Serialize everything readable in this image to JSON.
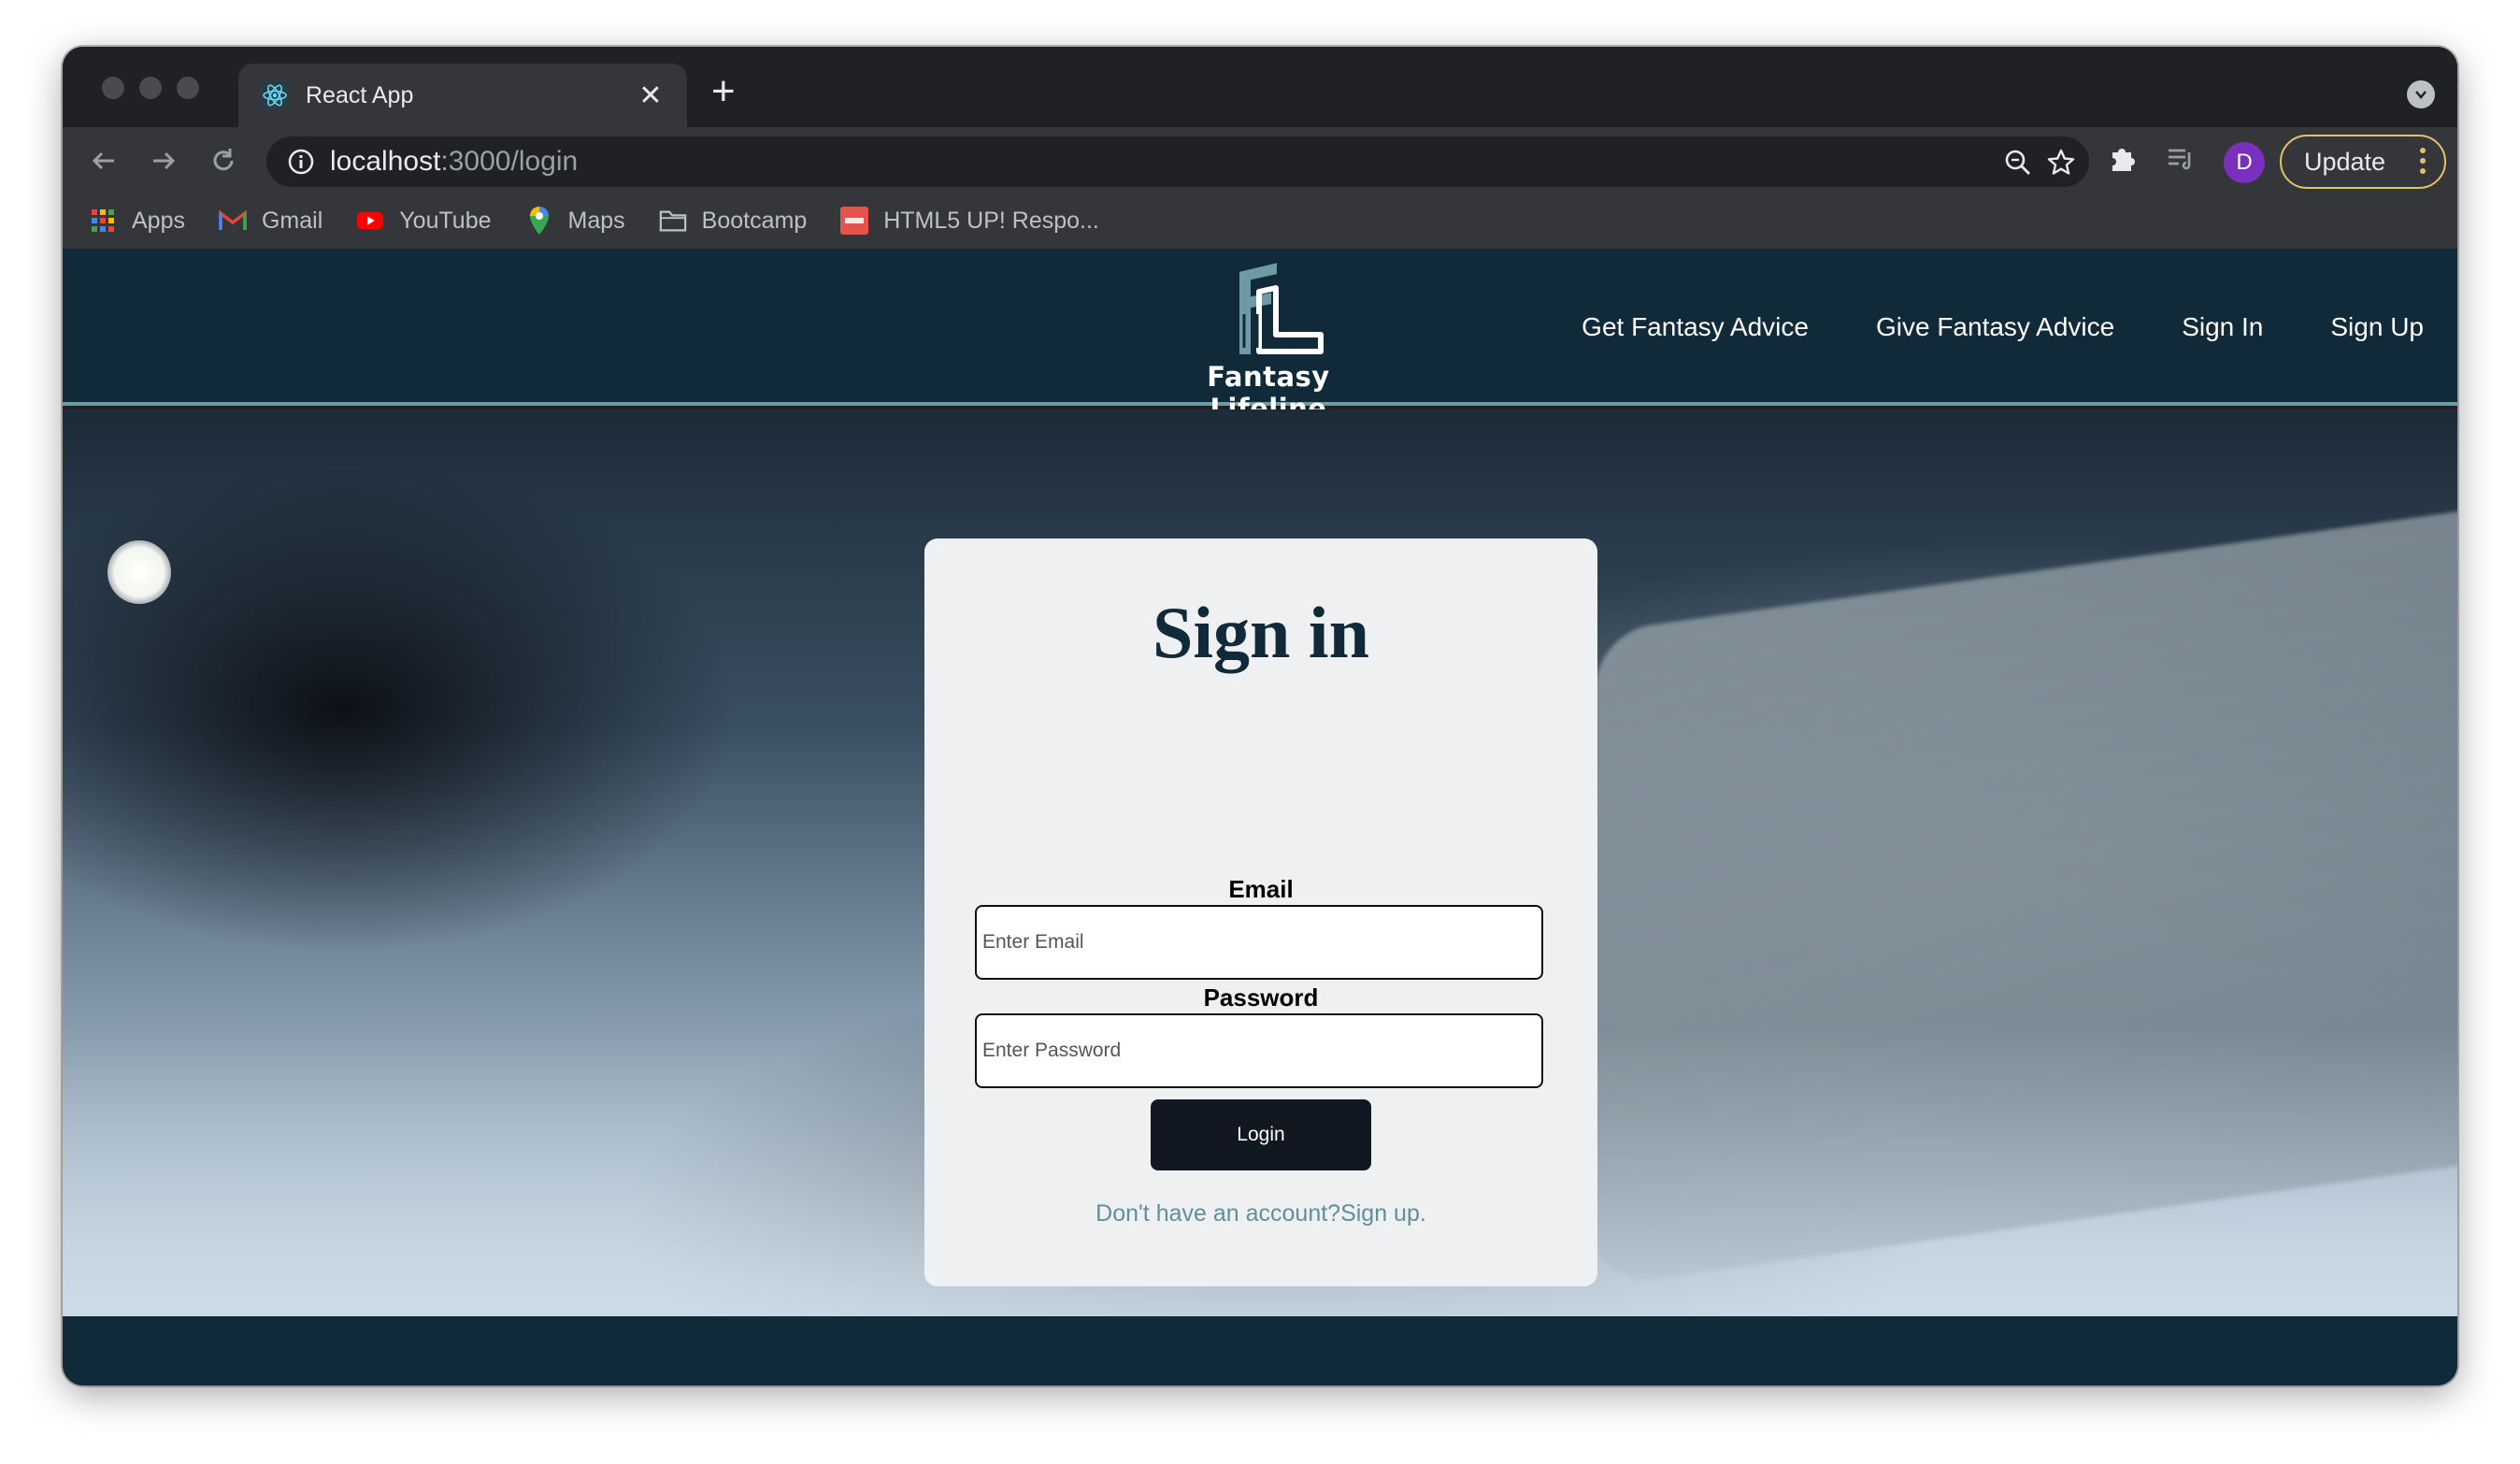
{
  "browser": {
    "tab_title": "React App",
    "url_host": "localhost",
    "url_path": ":3000/login",
    "update_label": "Update",
    "profile_initial": "D",
    "bookmarks": [
      {
        "label": "Apps",
        "icon": "apps-grid-icon"
      },
      {
        "label": "Gmail",
        "icon": "gmail-icon"
      },
      {
        "label": "YouTube",
        "icon": "youtube-icon"
      },
      {
        "label": "Maps",
        "icon": "maps-pin-icon"
      },
      {
        "label": "Bootcamp",
        "icon": "folder-icon"
      },
      {
        "label": "HTML5 UP! Respo...",
        "icon": "html5up-icon"
      }
    ]
  },
  "site": {
    "brand": "Fantasy Lifeline",
    "nav": [
      {
        "label": "Get Fantasy Advice"
      },
      {
        "label": "Give Fantasy Advice"
      },
      {
        "label": "Sign In"
      },
      {
        "label": "Sign Up"
      }
    ],
    "colors": {
      "navbar": "#102a39",
      "accent": "#6e9aa4",
      "button": "#111821"
    }
  },
  "login": {
    "heading": "Sign in",
    "email_label": "Email",
    "email_placeholder": "Enter Email",
    "password_label": "Password",
    "password_placeholder": "Enter Password",
    "login_label": "Login",
    "no_account_text": "Don't have an account?",
    "signup_link": "Sign up."
  }
}
